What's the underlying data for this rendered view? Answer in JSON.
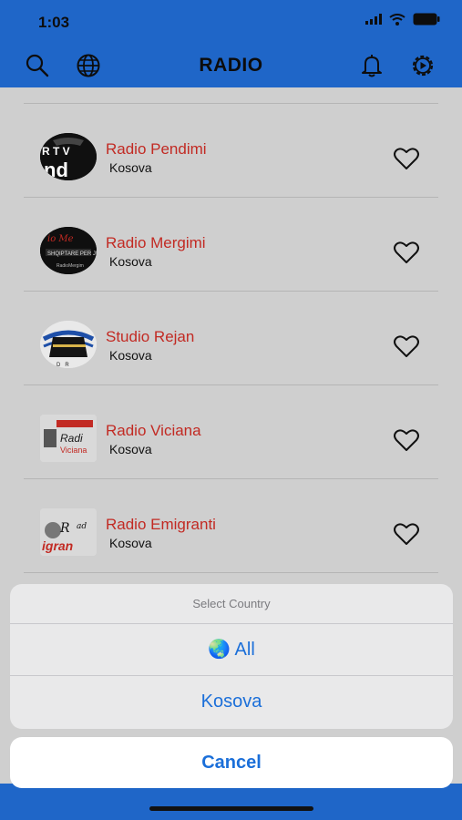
{
  "status_bar": {
    "time": "1:03"
  },
  "header": {
    "title": "RADIO",
    "icons": [
      "search-icon",
      "globe-icon",
      "bell-icon",
      "settings-icon"
    ]
  },
  "stations": [
    {
      "name": "Radio Pendimi",
      "country": "Kosova"
    },
    {
      "name": "Radio Mergimi",
      "country": "Kosova"
    },
    {
      "name": "Studio Rejan",
      "country": "Kosova"
    },
    {
      "name": "Radio Viciana",
      "country": "Kosova"
    },
    {
      "name": "Radio Emigranti",
      "country": "Kosova"
    }
  ],
  "action_sheet": {
    "title": "Select Country",
    "options": [
      {
        "label": "🌏 All"
      },
      {
        "label": "Kosova"
      }
    ],
    "cancel_label": "Cancel"
  },
  "colors": {
    "header_bg": "#1f66c8",
    "station_name": "#c22a23",
    "ios_blue": "#1b6fd9"
  }
}
